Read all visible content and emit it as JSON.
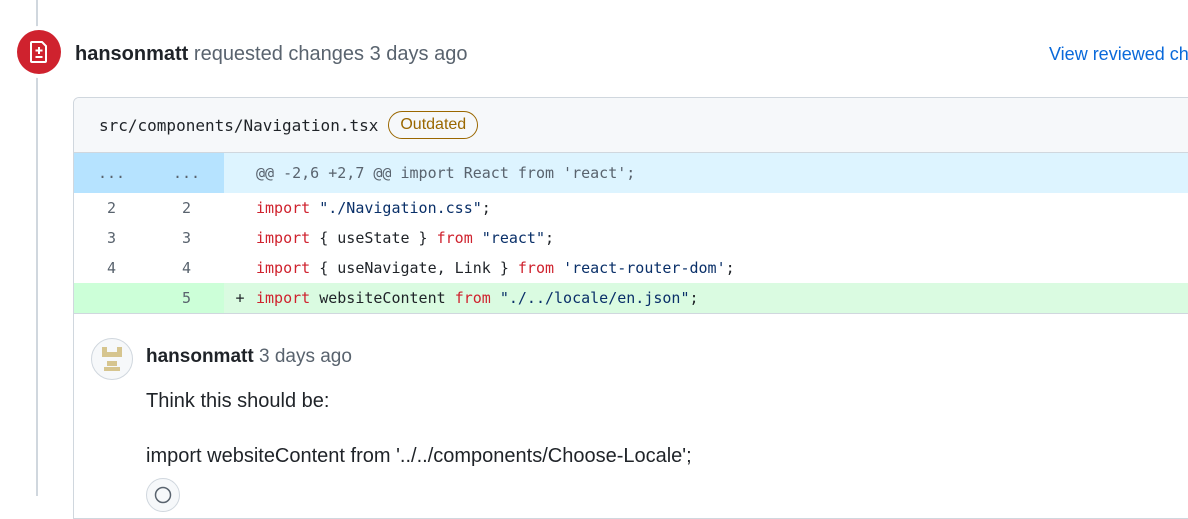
{
  "event": {
    "author": "hansonmatt",
    "action": "requested changes",
    "time": "3 days ago",
    "view_link": "View reviewed ch",
    "icon": "file-diff-icon"
  },
  "file": {
    "path": "src/components/Navigation.tsx",
    "badge": "Outdated"
  },
  "hunk": {
    "old_num": "...",
    "new_num": "...",
    "text": "@@ -2,6 +2,7 @@ import React from 'react';"
  },
  "lines": [
    {
      "old": "2",
      "new": "2",
      "sign": "",
      "kw1": "import",
      "mid": " ",
      "str": "\"./Navigation.css\"",
      "end": ";"
    },
    {
      "old": "3",
      "new": "3",
      "sign": "",
      "kw1": "import",
      "mid": " { useState } ",
      "kw2": "from",
      "str": "\"react\"",
      "end": ";"
    },
    {
      "old": "4",
      "new": "4",
      "sign": "",
      "kw1": "import",
      "mid": " { useNavigate, Link } ",
      "kw2": "from",
      "str": "'react-router-dom'",
      "end": ";"
    },
    {
      "old": "",
      "new": "5",
      "sign": "+",
      "kw1": "import",
      "mid": " websiteContent ",
      "kw2": "from",
      "str": "\"./../locale/en.json\"",
      "end": ";"
    }
  ],
  "comment": {
    "author": "hansonmatt",
    "time": "3 days ago",
    "body": [
      "Think this should be:",
      "import websiteContent from '../../components/Choose-Locale';"
    ],
    "avatar_icon": "identicon-avatar",
    "reaction_icon": "smiley-icon"
  },
  "colors": {
    "request_changes": "#cf222e",
    "link": "#0969da",
    "outdated": "#9a6700",
    "hunk_bg": "#ddf4ff",
    "add_bg": "#dafbe1"
  }
}
